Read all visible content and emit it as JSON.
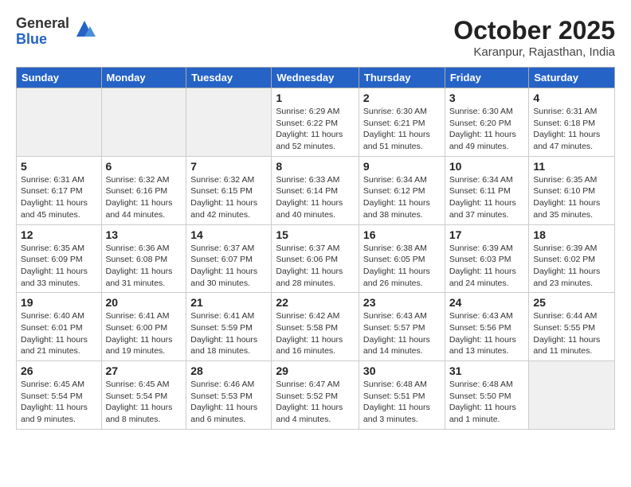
{
  "logo": {
    "general": "General",
    "blue": "Blue"
  },
  "title": "October 2025",
  "location": "Karanpur, Rajasthan, India",
  "weekdays": [
    "Sunday",
    "Monday",
    "Tuesday",
    "Wednesday",
    "Thursday",
    "Friday",
    "Saturday"
  ],
  "weeks": [
    [
      {
        "day": "",
        "info": ""
      },
      {
        "day": "",
        "info": ""
      },
      {
        "day": "",
        "info": ""
      },
      {
        "day": "1",
        "info": "Sunrise: 6:29 AM\nSunset: 6:22 PM\nDaylight: 11 hours and 52 minutes."
      },
      {
        "day": "2",
        "info": "Sunrise: 6:30 AM\nSunset: 6:21 PM\nDaylight: 11 hours and 51 minutes."
      },
      {
        "day": "3",
        "info": "Sunrise: 6:30 AM\nSunset: 6:20 PM\nDaylight: 11 hours and 49 minutes."
      },
      {
        "day": "4",
        "info": "Sunrise: 6:31 AM\nSunset: 6:18 PM\nDaylight: 11 hours and 47 minutes."
      }
    ],
    [
      {
        "day": "5",
        "info": "Sunrise: 6:31 AM\nSunset: 6:17 PM\nDaylight: 11 hours and 45 minutes."
      },
      {
        "day": "6",
        "info": "Sunrise: 6:32 AM\nSunset: 6:16 PM\nDaylight: 11 hours and 44 minutes."
      },
      {
        "day": "7",
        "info": "Sunrise: 6:32 AM\nSunset: 6:15 PM\nDaylight: 11 hours and 42 minutes."
      },
      {
        "day": "8",
        "info": "Sunrise: 6:33 AM\nSunset: 6:14 PM\nDaylight: 11 hours and 40 minutes."
      },
      {
        "day": "9",
        "info": "Sunrise: 6:34 AM\nSunset: 6:12 PM\nDaylight: 11 hours and 38 minutes."
      },
      {
        "day": "10",
        "info": "Sunrise: 6:34 AM\nSunset: 6:11 PM\nDaylight: 11 hours and 37 minutes."
      },
      {
        "day": "11",
        "info": "Sunrise: 6:35 AM\nSunset: 6:10 PM\nDaylight: 11 hours and 35 minutes."
      }
    ],
    [
      {
        "day": "12",
        "info": "Sunrise: 6:35 AM\nSunset: 6:09 PM\nDaylight: 11 hours and 33 minutes."
      },
      {
        "day": "13",
        "info": "Sunrise: 6:36 AM\nSunset: 6:08 PM\nDaylight: 11 hours and 31 minutes."
      },
      {
        "day": "14",
        "info": "Sunrise: 6:37 AM\nSunset: 6:07 PM\nDaylight: 11 hours and 30 minutes."
      },
      {
        "day": "15",
        "info": "Sunrise: 6:37 AM\nSunset: 6:06 PM\nDaylight: 11 hours and 28 minutes."
      },
      {
        "day": "16",
        "info": "Sunrise: 6:38 AM\nSunset: 6:05 PM\nDaylight: 11 hours and 26 minutes."
      },
      {
        "day": "17",
        "info": "Sunrise: 6:39 AM\nSunset: 6:03 PM\nDaylight: 11 hours and 24 minutes."
      },
      {
        "day": "18",
        "info": "Sunrise: 6:39 AM\nSunset: 6:02 PM\nDaylight: 11 hours and 23 minutes."
      }
    ],
    [
      {
        "day": "19",
        "info": "Sunrise: 6:40 AM\nSunset: 6:01 PM\nDaylight: 11 hours and 21 minutes."
      },
      {
        "day": "20",
        "info": "Sunrise: 6:41 AM\nSunset: 6:00 PM\nDaylight: 11 hours and 19 minutes."
      },
      {
        "day": "21",
        "info": "Sunrise: 6:41 AM\nSunset: 5:59 PM\nDaylight: 11 hours and 18 minutes."
      },
      {
        "day": "22",
        "info": "Sunrise: 6:42 AM\nSunset: 5:58 PM\nDaylight: 11 hours and 16 minutes."
      },
      {
        "day": "23",
        "info": "Sunrise: 6:43 AM\nSunset: 5:57 PM\nDaylight: 11 hours and 14 minutes."
      },
      {
        "day": "24",
        "info": "Sunrise: 6:43 AM\nSunset: 5:56 PM\nDaylight: 11 hours and 13 minutes."
      },
      {
        "day": "25",
        "info": "Sunrise: 6:44 AM\nSunset: 5:55 PM\nDaylight: 11 hours and 11 minutes."
      }
    ],
    [
      {
        "day": "26",
        "info": "Sunrise: 6:45 AM\nSunset: 5:54 PM\nDaylight: 11 hours and 9 minutes."
      },
      {
        "day": "27",
        "info": "Sunrise: 6:45 AM\nSunset: 5:54 PM\nDaylight: 11 hours and 8 minutes."
      },
      {
        "day": "28",
        "info": "Sunrise: 6:46 AM\nSunset: 5:53 PM\nDaylight: 11 hours and 6 minutes."
      },
      {
        "day": "29",
        "info": "Sunrise: 6:47 AM\nSunset: 5:52 PM\nDaylight: 11 hours and 4 minutes."
      },
      {
        "day": "30",
        "info": "Sunrise: 6:48 AM\nSunset: 5:51 PM\nDaylight: 11 hours and 3 minutes."
      },
      {
        "day": "31",
        "info": "Sunrise: 6:48 AM\nSunset: 5:50 PM\nDaylight: 11 hours and 1 minute."
      },
      {
        "day": "",
        "info": ""
      }
    ]
  ]
}
